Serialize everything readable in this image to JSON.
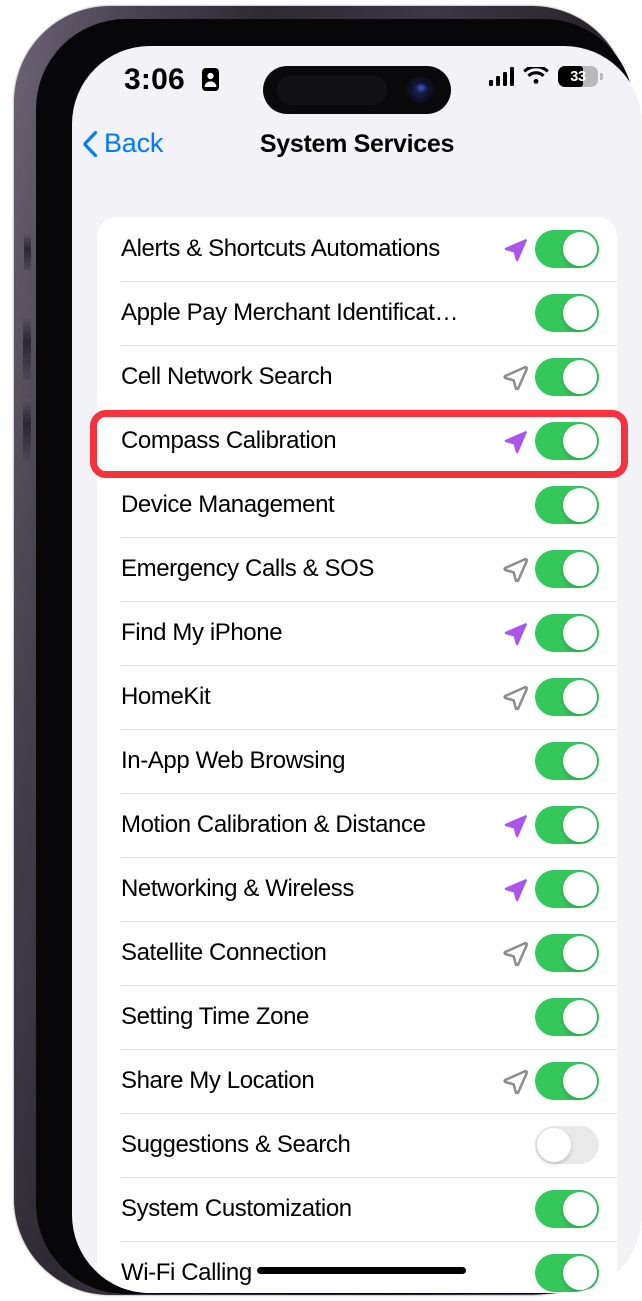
{
  "status_bar": {
    "time": "3:06",
    "focus_icon": "focus-person-badge-icon",
    "cellular_icon": "cellular-signal-icon",
    "wifi_icon": "wifi-icon",
    "battery_percent": "33",
    "battery_level_fraction": 0.62
  },
  "nav": {
    "back_label": "Back",
    "back_icon": "chevron-left-icon",
    "title": "System Services"
  },
  "colors": {
    "accent_blue": "#007AFF",
    "toggle_on_green": "#34C759",
    "toggle_off_gray": "#E9E9EA",
    "arrow_purple": "#A855E8",
    "arrow_gray": "#8E8E93",
    "highlight_red": "#F5333F",
    "page_background": "#F2F2F7"
  },
  "list": {
    "rows": [
      {
        "label": "Alerts & Shortcuts Automations",
        "arrow": "purple",
        "toggle": "on"
      },
      {
        "label": "Apple Pay Merchant Identificat…",
        "arrow": "none",
        "toggle": "on"
      },
      {
        "label": "Cell Network Search",
        "arrow": "gray",
        "toggle": "on"
      },
      {
        "label": "Compass Calibration",
        "arrow": "purple",
        "toggle": "on"
      },
      {
        "label": "Device Management",
        "arrow": "none",
        "toggle": "on"
      },
      {
        "label": "Emergency Calls & SOS",
        "arrow": "gray",
        "toggle": "on"
      },
      {
        "label": "Find My iPhone",
        "arrow": "purple",
        "toggle": "on"
      },
      {
        "label": "HomeKit",
        "arrow": "gray",
        "toggle": "on"
      },
      {
        "label": "In-App Web Browsing",
        "arrow": "none",
        "toggle": "on"
      },
      {
        "label": "Motion Calibration & Distance",
        "arrow": "purple",
        "toggle": "on"
      },
      {
        "label": "Networking & Wireless",
        "arrow": "purple",
        "toggle": "on"
      },
      {
        "label": "Satellite Connection",
        "arrow": "gray",
        "toggle": "on"
      },
      {
        "label": "Setting Time Zone",
        "arrow": "none",
        "toggle": "on"
      },
      {
        "label": "Share My Location",
        "arrow": "gray",
        "toggle": "on"
      },
      {
        "label": "Suggestions & Search",
        "arrow": "none",
        "toggle": "off"
      },
      {
        "label": "System Customization",
        "arrow": "none",
        "toggle": "on"
      },
      {
        "label": "Wi-Fi Calling",
        "arrow": "none",
        "toggle": "on"
      }
    ]
  },
  "annotation": {
    "highlight_target": "Compass Calibration",
    "shape": "rounded-rectangle-outline"
  }
}
